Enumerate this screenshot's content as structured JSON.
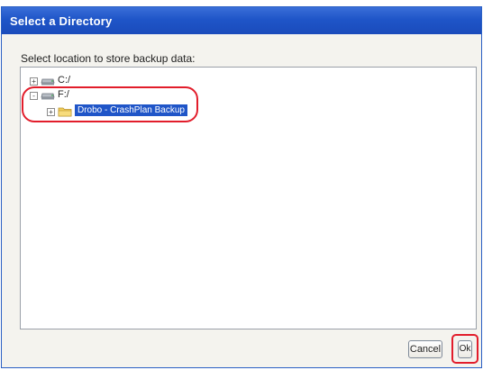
{
  "window": {
    "title": "Select a Directory"
  },
  "prompt": "Select location to store backup data:",
  "tree": {
    "nodes": [
      {
        "label": "C:/",
        "expander": "+",
        "icon": "drive-icon"
      },
      {
        "label": "F:/",
        "expander": "-",
        "icon": "drive-icon"
      },
      {
        "label": "Drobo - CrashPlan Backup",
        "expander": "+",
        "icon": "folder-icon",
        "selected": true
      }
    ]
  },
  "buttons": {
    "cancel": "Cancel",
    "ok": "Ok"
  },
  "colors": {
    "titlebar": "#1f55c8",
    "selection": "#1f55c8",
    "annotation": "#e21d2b"
  }
}
